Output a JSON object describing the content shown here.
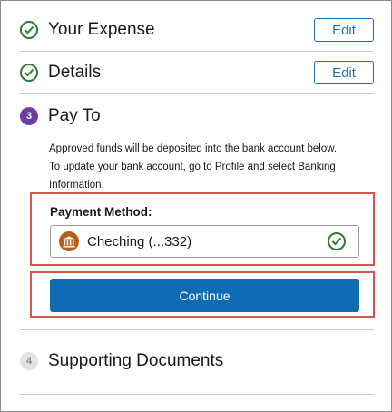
{
  "steps": {
    "expense": {
      "title": "Your Expense",
      "edit_label": "Edit"
    },
    "details": {
      "title": "Details",
      "edit_label": "Edit"
    },
    "pay_to": {
      "number": "3",
      "title": "Pay To",
      "info_line1": "Approved funds will be deposited into the bank account below.",
      "info_line2": "To update your bank account, go to Profile and select Banking Information."
    },
    "supporting": {
      "number": "4",
      "title": "Supporting Documents"
    }
  },
  "payment_method": {
    "label": "Payment Method:",
    "value": "Cheching (...332)"
  },
  "continue_label": "Continue",
  "colors": {
    "accent": "#0f6cb3",
    "success": "#2e7d32",
    "active_step": "#6b3fa0",
    "highlight": "#d9534f",
    "bank_icon": "#b85c1c"
  },
  "icons": {
    "completed": "check-circle-icon",
    "bank": "bank-icon",
    "selected": "check-circle-icon"
  }
}
